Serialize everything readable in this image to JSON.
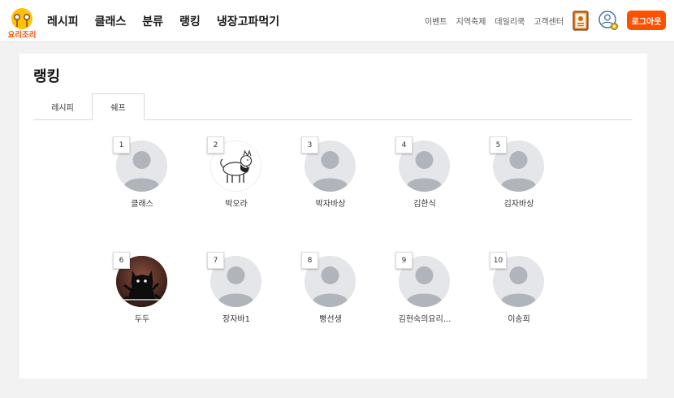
{
  "header": {
    "logo_text": "요리조리",
    "nav": [
      "레시피",
      "클래스",
      "분류",
      "랭킹",
      "냉장고파먹기"
    ],
    "util_links": [
      "이벤트",
      "지역축제",
      "데일리쿡",
      "고객센터"
    ],
    "logout_label": "로그아웃",
    "accent_color": "#ff5000",
    "logo_color": "#ffc107"
  },
  "page": {
    "title": "랭킹",
    "tabs": [
      "레시피",
      "쉐프"
    ],
    "active_tab": "쉐프"
  },
  "chefs": [
    {
      "rank": "1",
      "name": "클래스",
      "avatar": "default-avatar"
    },
    {
      "rank": "2",
      "name": "박오라",
      "avatar": "dog-illustration"
    },
    {
      "rank": "3",
      "name": "박자바상",
      "avatar": "default-avatar"
    },
    {
      "rank": "4",
      "name": "김한식",
      "avatar": "default-avatar"
    },
    {
      "rank": "5",
      "name": "김자바상",
      "avatar": "default-avatar"
    },
    {
      "rank": "6",
      "name": "두두",
      "avatar": "black-cat-photo"
    },
    {
      "rank": "7",
      "name": "장자바1",
      "avatar": "default-avatar"
    },
    {
      "rank": "8",
      "name": "빵선생",
      "avatar": "default-avatar"
    },
    {
      "rank": "9",
      "name": "김현숙의요리...",
      "avatar": "default-avatar"
    },
    {
      "rank": "10",
      "name": "이송희",
      "avatar": "default-avatar"
    }
  ]
}
